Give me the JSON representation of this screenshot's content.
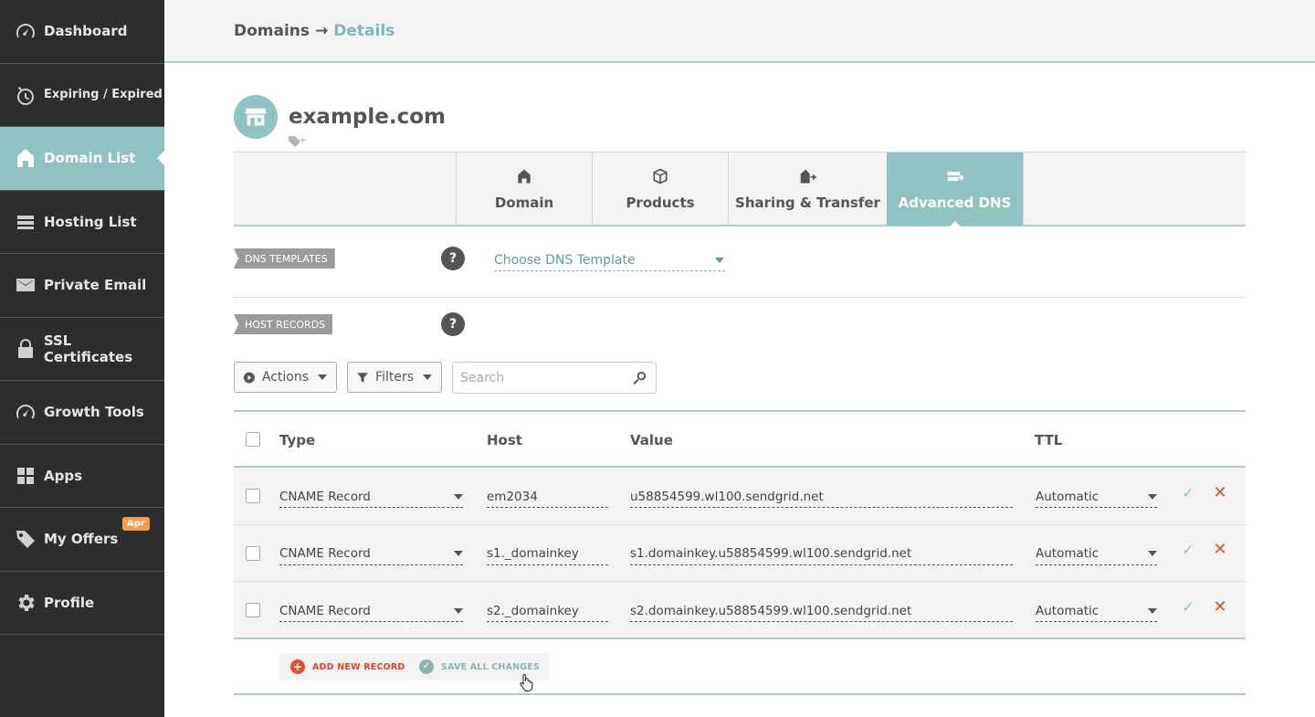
{
  "sidebar": {
    "items": [
      {
        "label": "Dashboard",
        "icon": "speedometer-icon"
      },
      {
        "label": "Expiring / Expired",
        "icon": "timer-icon"
      },
      {
        "label": "Domain List",
        "icon": "home-icon",
        "active": true
      },
      {
        "label": "Hosting List",
        "icon": "server-icon"
      },
      {
        "label": "Private Email",
        "icon": "envelope-icon"
      },
      {
        "label": "SSL Certificates",
        "icon": "lock-icon"
      },
      {
        "label": "Growth Tools",
        "icon": "speedometer-icon"
      },
      {
        "label": "Apps",
        "icon": "apps-icon"
      },
      {
        "label": "My Offers",
        "icon": "tag-icon",
        "badge": "Apr"
      },
      {
        "label": "Profile",
        "icon": "gear-icon"
      }
    ]
  },
  "breadcrumb": {
    "parent": "Domains",
    "arrow": "→",
    "current": "Details"
  },
  "domain": {
    "name": "example.com"
  },
  "tabs": [
    {
      "label": "Domain",
      "icon": "home-icon"
    },
    {
      "label": "Products",
      "icon": "box-icon"
    },
    {
      "label": "Sharing & Transfer",
      "icon": "house-transfer-icon"
    },
    {
      "label": "Advanced DNS",
      "icon": "server-gear-icon",
      "active": true
    }
  ],
  "dns_templates": {
    "label": "DNS TEMPLATES",
    "help": "?",
    "select_value": "Choose DNS Template"
  },
  "host_records": {
    "label": "HOST RECORDS",
    "help": "?"
  },
  "toolbar": {
    "actions_label": "Actions",
    "filters_label": "Filters",
    "search_placeholder": "Search"
  },
  "table": {
    "headers": {
      "type": "Type",
      "host": "Host",
      "value": "Value",
      "ttl": "TTL"
    },
    "rows": [
      {
        "type": "CNAME Record",
        "host": "em2034",
        "value": "u58854599.wl100.sendgrid.net",
        "ttl": "Automatic",
        "save": "✓",
        "delete": "✕"
      },
      {
        "type": "CNAME Record",
        "host": "s1._domainkey",
        "value": "s1.domainkey.u58854599.wl100.sendgrid.net",
        "ttl": "Automatic",
        "save": "✓",
        "delete": "✕"
      },
      {
        "type": "CNAME Record",
        "host": "s2._domainkey",
        "value": "s2.domainkey.u58854599.wl100.sendgrid.net",
        "ttl": "Automatic",
        "save": "✓",
        "delete": "✕"
      }
    ]
  },
  "footer": {
    "add_label": "ADD NEW RECORD",
    "add_symbol": "+",
    "save_label": "SAVE ALL CHANGES",
    "save_symbol": "✓"
  },
  "colors": {
    "accent": "#8fc3c1",
    "sidebar_bg": "#2d2d2d",
    "danger": "#e0522b",
    "badge": "#f39c4a"
  }
}
